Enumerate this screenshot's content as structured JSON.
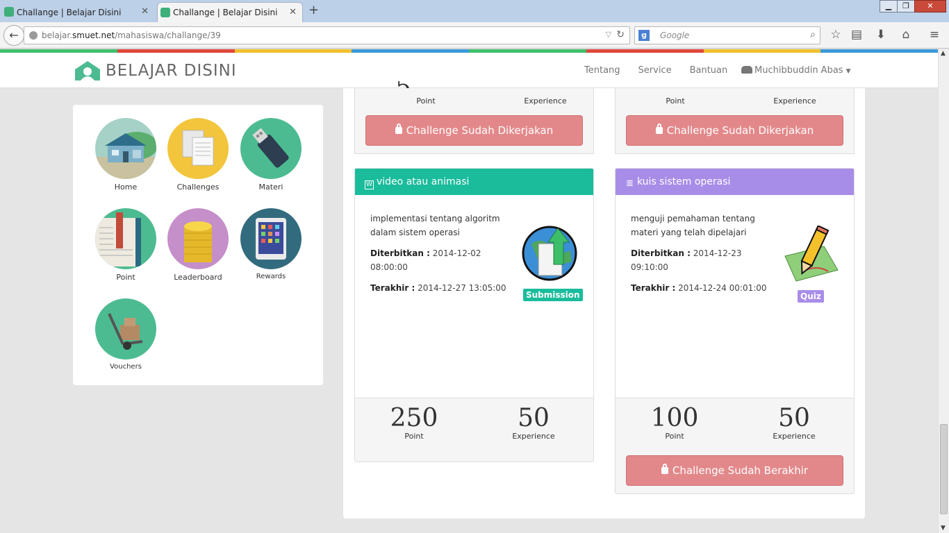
{
  "browser": {
    "tabs": [
      {
        "title": "Challange | Belajar Disini"
      },
      {
        "title": "Challange | Belajar Disini"
      }
    ],
    "url_prefix": "belajar.",
    "url_host": "smuet.net",
    "url_path": "/mahasiswa/challange/39",
    "search_placeholder": "Google"
  },
  "site": {
    "brand": "BELAJAR DISINI",
    "stripe_colors": [
      "#3dbf6a",
      "#e0463c",
      "#f0c02c",
      "#3a9ad9",
      "#3dbf6a",
      "#e0463c",
      "#f0c02c",
      "#3a9ad9"
    ],
    "nav": [
      "Tentang",
      "Service",
      "Bantuan"
    ],
    "user": "Muchibbuddin Abas"
  },
  "sidebar": {
    "items": [
      {
        "label": "Home",
        "icon": "home-icon",
        "color": "#a5d1c6"
      },
      {
        "label": "Challenges",
        "icon": "documents-icon",
        "color": "#f2c53d"
      },
      {
        "label": "Materi",
        "icon": "usb-drive-icon",
        "color": "#4dbb91"
      },
      {
        "label": "Point",
        "icon": "book-icon",
        "color": "#4dbb91"
      },
      {
        "label": "Leaderboard",
        "icon": "coins-icon",
        "color": "#c58fc9"
      },
      {
        "label": "Rewards",
        "icon": "tablet-icon",
        "color": "#336b7e"
      },
      {
        "label": "Vouchers",
        "icon": "hand-truck-icon",
        "color": "#4dbb91"
      }
    ]
  },
  "top_cards": [
    {
      "point_label": "Point",
      "exp_label": "Experience",
      "button": "Challenge Sudah Dikerjakan"
    },
    {
      "point_label": "Point",
      "exp_label": "Experience",
      "button": "Challenge Sudah Dikerjakan"
    }
  ],
  "cards": [
    {
      "title": "video atau animasi",
      "header_color": "#1abc9c",
      "description": "implementasi tentang algoritm dalam sistem operasi",
      "published_label": "Diterbitkan :",
      "published": "2014-12-02 08:00:00",
      "deadline_label": "Terakhir :",
      "deadline": "2014-12-27 13:05:00",
      "type_badge": "Submission",
      "badge_color": "#1abc9c",
      "icon": "globe-upload-icon",
      "point": "250",
      "point_label": "Point",
      "experience": "50",
      "exp_label": "Experience"
    },
    {
      "title": "kuis sistem operasi",
      "header_color": "#a88de8",
      "description": "menguji pemahaman tentang materi yang telah dipelajari",
      "published_label": "Diterbitkan :",
      "published": "2014-12-23 09:10:00",
      "deadline_label": "Terakhir :",
      "deadline": "2014-12-24 00:01:00",
      "type_badge": "Quiz",
      "badge_color": "#a88de8",
      "icon": "pencil-paper-icon",
      "point": "100",
      "point_label": "Point",
      "experience": "50",
      "exp_label": "Experience",
      "button": "Challenge Sudah Berakhir"
    }
  ]
}
